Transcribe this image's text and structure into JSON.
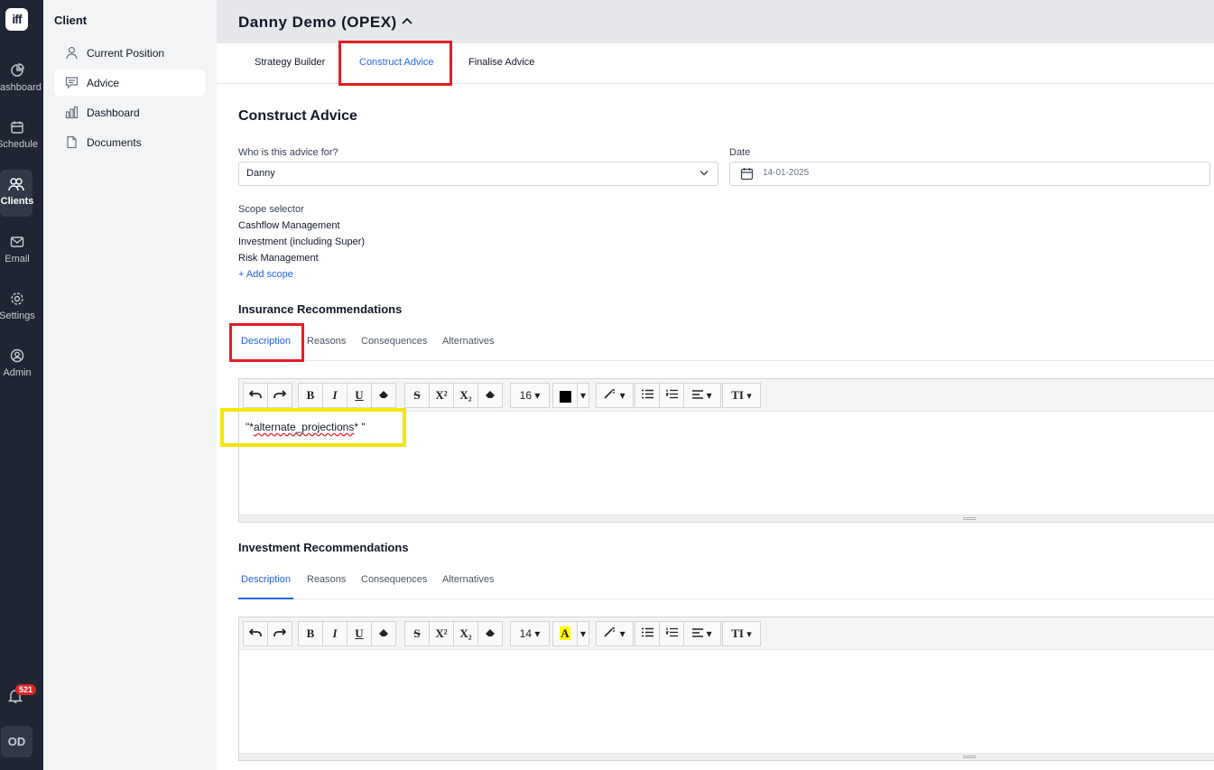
{
  "rail": {
    "logo": "iff",
    "items": [
      {
        "label": "Dashboard",
        "icon": "chart-pie-icon"
      },
      {
        "label": "Schedule",
        "icon": "calendar-icon"
      },
      {
        "label": "Clients",
        "icon": "users-icon"
      },
      {
        "label": "Email",
        "icon": "mail-icon"
      },
      {
        "label": "Settings",
        "icon": "gear-icon"
      },
      {
        "label": "Admin",
        "icon": "user-circle-icon"
      }
    ],
    "notifications": "521",
    "avatar": "OD"
  },
  "sidebar": {
    "title": "Client",
    "items": [
      {
        "label": "Current Position",
        "icon": "user-icon"
      },
      {
        "label": "Advice",
        "icon": "message-icon"
      },
      {
        "label": "Dashboard",
        "icon": "bar-chart-icon"
      },
      {
        "label": "Documents",
        "icon": "document-icon"
      }
    ]
  },
  "header": {
    "client": "Danny Demo (OPEX)",
    "tabs": [
      "Strategy Builder",
      "Construct Advice",
      "Finalise Advice"
    ]
  },
  "form": {
    "title": "Construct Advice",
    "who_label": "Who is this advice for?",
    "who_value": "Danny",
    "date_label": "Date",
    "date_value": "14-01-2025",
    "scope_label": "Scope selector",
    "scopes": [
      "Cashflow Management",
      "Investment (including Super)",
      "Risk Management"
    ],
    "add_scope": "+ Add scope"
  },
  "insurance": {
    "title": "Insurance Recommendations",
    "tabs": [
      "Description",
      "Reasons",
      "Consequences",
      "Alternatives"
    ],
    "font_size": "16",
    "content_prefix": "\"*",
    "content_word": "alternate_projections",
    "content_suffix": "* \""
  },
  "investment": {
    "title": "Investment Recommendations",
    "tabs": [
      "Description",
      "Reasons",
      "Consequences",
      "Alternatives"
    ],
    "font_size": "14"
  },
  "toolbar_glyphs": {
    "bold": "B",
    "italic": "I",
    "underline": "U",
    "strike": "S",
    "superscript": "X²",
    "subscript": "X₂",
    "text_size": "TI"
  },
  "colors": {
    "accent": "#2563eb",
    "rail_bg": "#1f2533",
    "annotation_red": "#e11d24",
    "annotation_yellow": "#f5e60b",
    "highlight_yellow": "#ffff00"
  }
}
